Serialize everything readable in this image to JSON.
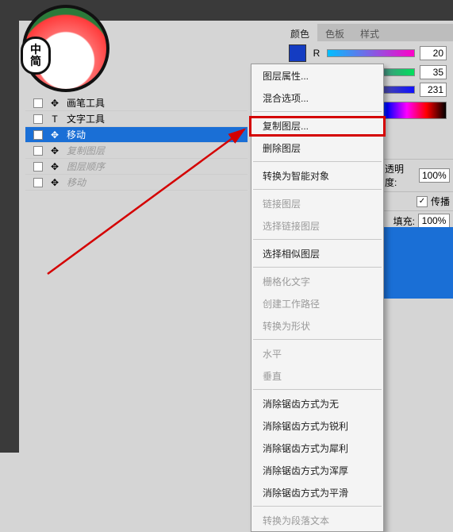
{
  "avatar_badge": {
    "l1": "中",
    "l2": "简"
  },
  "tools": [
    {
      "name": "画笔工具",
      "sel": false,
      "faded": false,
      "icon": "brush"
    },
    {
      "name": "文字工具",
      "sel": false,
      "faded": false,
      "icon": "T"
    },
    {
      "name": "移动",
      "sel": true,
      "faded": false,
      "icon": "move"
    },
    {
      "name": "复制图层",
      "sel": false,
      "faded": true,
      "icon": "layers"
    },
    {
      "name": "图层顺序",
      "sel": false,
      "faded": true,
      "icon": "layers"
    },
    {
      "name": "移动",
      "sel": false,
      "faded": true,
      "icon": "move"
    }
  ],
  "panel_tabs": [
    "颜色",
    "色板",
    "样式"
  ],
  "color": {
    "r": {
      "label": "R",
      "value": "20"
    },
    "g": {
      "label": "",
      "value": "35"
    },
    "b": {
      "label": "",
      "value": "231"
    }
  },
  "layers": {
    "opacity_label": "透明度:",
    "opacity_value": "100%",
    "propagate_label": "传播",
    "fill_label": "填充:",
    "fill_value": "100%"
  },
  "menu": [
    {
      "t": "图层属性...",
      "d": false
    },
    {
      "t": "混合选项...",
      "d": false
    },
    {
      "sep": true
    },
    {
      "t": "复制图层...",
      "d": false,
      "hl": true
    },
    {
      "t": "删除图层",
      "d": false
    },
    {
      "sep": true
    },
    {
      "t": "转换为智能对象",
      "d": false
    },
    {
      "sep": true
    },
    {
      "t": "链接图层",
      "d": true
    },
    {
      "t": "选择链接图层",
      "d": true
    },
    {
      "sep": true
    },
    {
      "t": "选择相似图层",
      "d": false
    },
    {
      "sep": true
    },
    {
      "t": "栅格化文字",
      "d": true
    },
    {
      "t": "创建工作路径",
      "d": true
    },
    {
      "t": "转换为形状",
      "d": true
    },
    {
      "sep": true
    },
    {
      "t": "水平",
      "d": true
    },
    {
      "t": "垂直",
      "d": true
    },
    {
      "sep": true
    },
    {
      "t": "消除锯齿方式为无",
      "d": false
    },
    {
      "t": "消除锯齿方式为锐利",
      "d": false
    },
    {
      "t": "消除锯齿方式为犀利",
      "d": false
    },
    {
      "t": "消除锯齿方式为浑厚",
      "d": false
    },
    {
      "t": "消除锯齿方式为平滑",
      "d": false
    },
    {
      "sep": true
    },
    {
      "t": "转换为段落文本",
      "d": true
    }
  ]
}
